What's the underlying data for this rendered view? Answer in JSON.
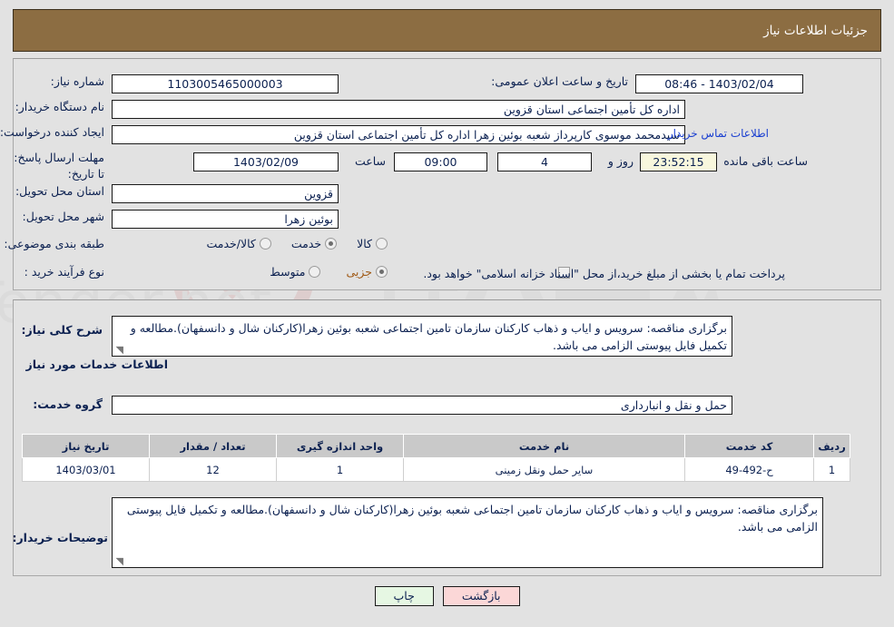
{
  "header": {
    "title": "جزئیات اطلاعات نیاز"
  },
  "colors": {
    "header_bar": "#8c6d42",
    "page_bg": "#e2e2e2",
    "text": "#0b2050",
    "link": "#1a3fd0",
    "selected_radio_text": "#a05a16",
    "countdown_bg": "#f8f7dd",
    "table_header_bg": "#c9c9c9",
    "back_button_bg": "#fbd7d7",
    "print_button_bg": "#e6f7e3"
  },
  "top_panel": {
    "need_number_label": "شماره نیاز:",
    "need_number_value": "1103005465000003",
    "announce_datetime_label": "تاریخ و ساعت اعلان عمومی:",
    "announce_datetime_value": "1403/02/04 - 08:46",
    "buyer_org_label": "نام دستگاه خریدار:",
    "buyer_org_value": "اداره کل تأمین اجتماعی استان قزوین",
    "creator_label": "ایجاد کننده درخواست:",
    "creator_value": "سیدمحمد موسوی کارپرداز شعبه بوئین زهرا  اداره کل تأمین اجتماعی استان قزوین",
    "contact_link": "اطلاعات تماس خریدار",
    "deadline_label": "مهلت ارسال پاسخ: تا تاریخ:",
    "deadline_date": "1403/02/09",
    "deadline_hour_label": "ساعت",
    "deadline_hour": "09:00",
    "remaining_days": "4",
    "remaining_days_label": "روز و",
    "remaining_time": "23:52:15",
    "remaining_suffix_label": "ساعت باقی مانده",
    "province_label": "استان محل تحویل:",
    "province_value": "قزوین",
    "city_label": "شهر محل تحویل:",
    "city_value": "بوئین زهرا",
    "category_label": "طبقه بندی موضوعی:",
    "category_options": [
      {
        "label": "کالا",
        "selected": false
      },
      {
        "label": "خدمت",
        "selected": true
      },
      {
        "label": "کالا/خدمت",
        "selected": false
      }
    ],
    "process_label": "نوع فرآیند خرید :",
    "process_options": [
      {
        "label": "جزیی",
        "selected": true
      },
      {
        "label": "متوسط",
        "selected": false
      }
    ],
    "treasury_checkbox_checked": false,
    "treasury_text": "پرداخت تمام یا بخشی از مبلغ خرید،از محل \"اسناد خزانه اسلامی\" خواهد بود."
  },
  "bottom_panel": {
    "summary_label": "شرح کلی نیاز:",
    "summary_text": "برگزاری مناقصه: سرویس و ایاب و ذهاب کارکنان سازمان تامین اجتماعی شعبه بوئین زهرا(کارکنان شال و دانسفهان).مطالعه و تکمیل فایل پیوستی الزامی می باشد.",
    "services_heading": "اطلاعات خدمات مورد نیاز",
    "service_group_label": "گروه خدمت:",
    "service_group_value": "حمل و نقل و انبارداری",
    "table": {
      "columns": [
        "ردیف",
        "کد خدمت",
        "نام خدمت",
        "واحد اندازه گیری",
        "تعداد / مقدار",
        "تاریخ نیاز"
      ],
      "rows": [
        {
          "row": "1",
          "service_code": "ح-492-49",
          "service_name": "سایر حمل ونقل زمینی",
          "unit": "1",
          "quantity": "12",
          "need_date": "1403/03/01"
        }
      ]
    },
    "buyer_notes_label": "توضیحات خریدار:",
    "buyer_notes_text": "برگزاری مناقصه: سرویس و ایاب و ذهاب کارکنان سازمان تامین اجتماعی شعبه بوئین زهرا(کارکنان شال و دانسفهان).مطالعه و تکمیل فایل پیوستی الزامی می باشد."
  },
  "footer": {
    "back_button": "بازگشت",
    "print_button": "چاپ"
  },
  "watermark": {
    "text": "AnaTender.net"
  }
}
